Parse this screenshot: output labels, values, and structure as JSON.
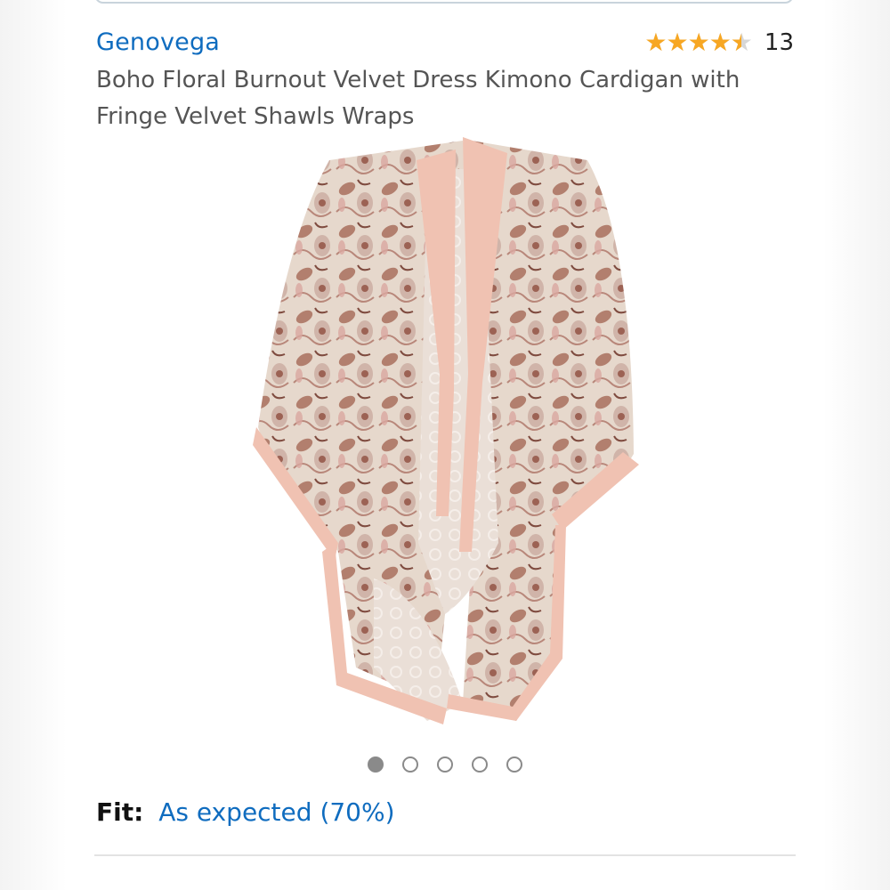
{
  "product": {
    "brand": "Genovega",
    "title": "Boho Floral Burnout Velvet Dress Kimono Cardigan with Fringe Velvet Shawls Wraps",
    "rating": {
      "stars": "★★★★★",
      "value": 4.5,
      "max": 5,
      "count": "13"
    },
    "image_carousel": {
      "total": 5,
      "active_index": 0
    }
  },
  "fit": {
    "label": "Fit:",
    "value": "As expected (70%)"
  },
  "colors": {
    "link": "#0f6cbf",
    "star": "#f7a723",
    "kimono_border": "#f0c2b2",
    "kimono_pattern": "#9a5a4a"
  },
  "icons": {
    "rating": "star-icon",
    "carousel": "dot-indicator-icon"
  }
}
